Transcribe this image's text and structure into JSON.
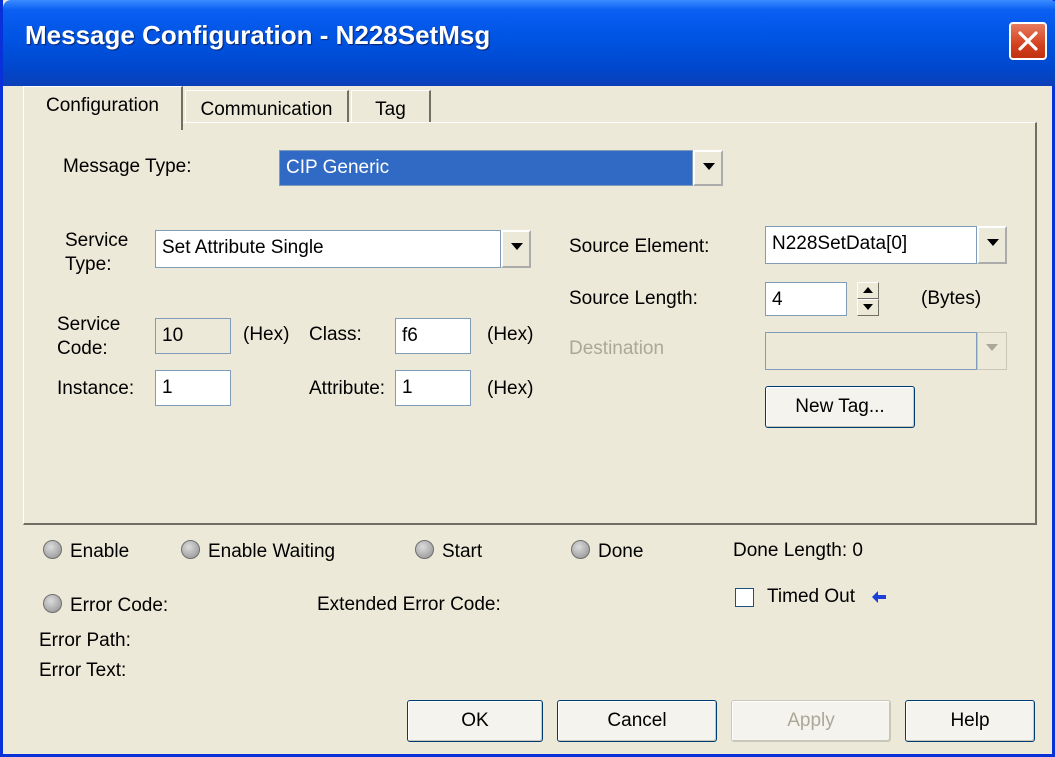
{
  "window": {
    "title": "Message Configuration - N228SetMsg"
  },
  "tabs": [
    {
      "label": "Configuration"
    },
    {
      "label": "Communication"
    },
    {
      "label": "Tag"
    }
  ],
  "config": {
    "message_type_label": "Message Type:",
    "message_type_value": "CIP Generic",
    "service_type_label_1": "Service",
    "service_type_label_2": "Type:",
    "service_type_value": "Set Attribute Single",
    "service_code_label_1": "Service",
    "service_code_label_2": "Code:",
    "service_code_value": "10",
    "hex_label_1": "(Hex)",
    "class_label": "Class:",
    "class_value": "f6",
    "hex_label_2": "(Hex)",
    "instance_label": "Instance:",
    "instance_value": "1",
    "attribute_label": "Attribute:",
    "attribute_value": "1",
    "hex_label_3": "(Hex)",
    "source_element_label": "Source Element:",
    "source_element_value": "N228SetData[0]",
    "source_length_label": "Source Length:",
    "source_length_value": "4",
    "bytes_label": "(Bytes)",
    "destination_label": "Destination",
    "destination_value": "",
    "new_tag_button": "New Tag..."
  },
  "status": {
    "enable": "Enable",
    "enable_waiting": "Enable Waiting",
    "start": "Start",
    "done": "Done",
    "done_length": "Done Length: 0",
    "error_code": "Error Code:",
    "extended_error_code": "Extended Error Code:",
    "timed_out": "Timed Out",
    "error_path": "Error Path:",
    "error_text": "Error Text:"
  },
  "buttons": {
    "ok": "OK",
    "cancel": "Cancel",
    "apply": "Apply",
    "help": "Help"
  },
  "colors": {
    "title_bar": "#0054e3",
    "selection": "#316ac5",
    "window_bg": "#ece9d8",
    "close": "#d3421f"
  }
}
